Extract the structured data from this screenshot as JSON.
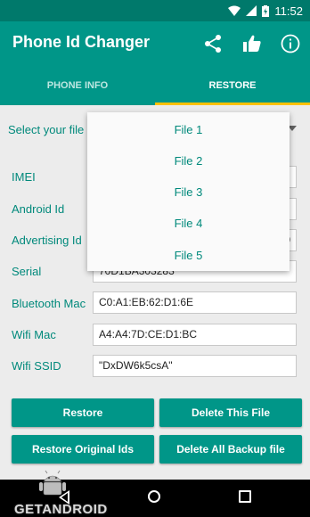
{
  "status_bar": {
    "time": "11:52",
    "icons": [
      "wifi-icon",
      "signal-icon",
      "battery-charging-icon"
    ]
  },
  "app_bar": {
    "title": "Phone Id Changer",
    "icons": [
      "share-icon",
      "thumbs-up-icon",
      "info-icon"
    ]
  },
  "tabs": [
    {
      "label": "PHONE INFO",
      "selected": false
    },
    {
      "label": "RESTORE",
      "selected": true
    }
  ],
  "colors": {
    "primary": "#009688",
    "primary_dark": "#00796B",
    "accent": "#FFC107",
    "label_text": "#00897B"
  },
  "restore": {
    "select_label": "Select your file :",
    "fields": [
      {
        "label": "IMEI",
        "value": ""
      },
      {
        "label": "Android Id",
        "value": ""
      },
      {
        "label": "Advertising Id",
        "value": "0"
      },
      {
        "label": "Serial",
        "value": "70D1BA303283"
      },
      {
        "label": "Bluetooth Mac",
        "value": "C0:A1:EB:62:D1:6E"
      },
      {
        "label": "Wifi Mac",
        "value": "A4:A4:7D:CE:D1:BC"
      },
      {
        "label": "Wifi SSID",
        "value": "\"DxDW6k5csA\""
      }
    ],
    "buttons": {
      "restore": "Restore",
      "delete_file": "Delete This File",
      "restore_original": "Restore Original Ids",
      "delete_all": "Delete All Backup file"
    }
  },
  "dropdown": {
    "items": [
      "File 1",
      "File 2",
      "File 3",
      "File 4",
      "File 5"
    ]
  },
  "nav_bar": {
    "icons": [
      "back-icon",
      "home-icon",
      "recent-apps-icon"
    ]
  },
  "watermark": {
    "text": "GETANDROID",
    "icon": "android-robot-icon"
  }
}
